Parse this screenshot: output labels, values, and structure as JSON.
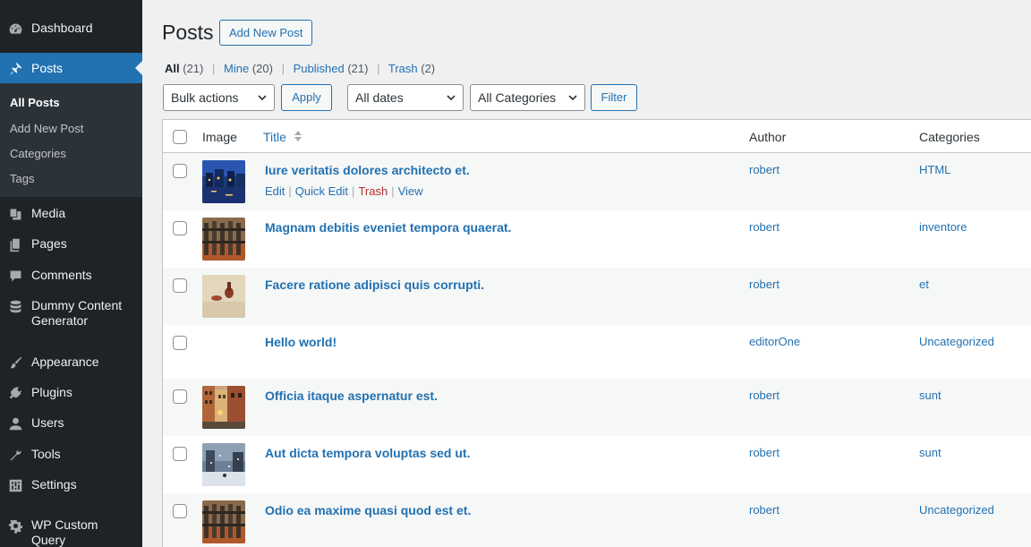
{
  "sidebar": {
    "items": [
      {
        "label": "Dashboard",
        "icon": "dashboard-icon"
      },
      {
        "label": "Posts",
        "icon": "pushpin-icon"
      },
      {
        "label": "Media",
        "icon": "media-icon"
      },
      {
        "label": "Pages",
        "icon": "pages-icon"
      },
      {
        "label": "Comments",
        "icon": "comments-icon"
      },
      {
        "label": "Dummy Content Generator",
        "icon": "database-icon"
      },
      {
        "label": "Appearance",
        "icon": "paintbrush-icon"
      },
      {
        "label": "Plugins",
        "icon": "plugin-icon"
      },
      {
        "label": "Users",
        "icon": "users-icon"
      },
      {
        "label": "Tools",
        "icon": "wrench-icon"
      },
      {
        "label": "Settings",
        "icon": "settings-icon"
      },
      {
        "label": "WP Custom Query",
        "icon": "gear-icon"
      }
    ],
    "submenu": [
      "All Posts",
      "Add New Post",
      "Categories",
      "Tags"
    ]
  },
  "header": {
    "title": "Posts",
    "add_new": "Add New Post"
  },
  "views": [
    {
      "label": "All",
      "count": "(21)"
    },
    {
      "label": "Mine",
      "count": "(20)"
    },
    {
      "label": "Published",
      "count": "(21)"
    },
    {
      "label": "Trash",
      "count": "(2)"
    }
  ],
  "filters": {
    "bulk_actions": "Bulk actions",
    "apply": "Apply",
    "dates": "All dates",
    "categories": "All Categories",
    "filter": "Filter"
  },
  "table": {
    "columns": [
      "Image",
      "Title",
      "Author",
      "Categories"
    ],
    "row_actions": [
      "Edit",
      "Quick Edit",
      "Trash",
      "View"
    ],
    "rows": [
      {
        "title": "Iure veritatis dolores architecto et.",
        "author": "robert",
        "category": "HTML",
        "thumb": "night-canal"
      },
      {
        "title": "Magnam debitis eveniet tempora quaerat.",
        "author": "robert",
        "category": "inventore",
        "thumb": "fence-autumn"
      },
      {
        "title": "Facere ratione adipisci quis corrupti.",
        "author": "robert",
        "category": "et",
        "thumb": "wax-seal"
      },
      {
        "title": "Hello world!",
        "author": "editorOne",
        "category": "Uncategorized",
        "thumb": "none"
      },
      {
        "title": "Officia itaque aspernatur est.",
        "author": "robert",
        "category": "sunt",
        "thumb": "street-buildings"
      },
      {
        "title": "Aut dicta tempora voluptas sed ut.",
        "author": "robert",
        "category": "sunt",
        "thumb": "snowy-street"
      },
      {
        "title": "Odio ea maxime quasi quod est et.",
        "author": "robert",
        "category": "Uncategorized",
        "thumb": "fence-autumn"
      }
    ]
  },
  "colors": {
    "sidebar_bg": "#1d2327",
    "accent": "#2271b1",
    "trash": "#b32d2e"
  }
}
